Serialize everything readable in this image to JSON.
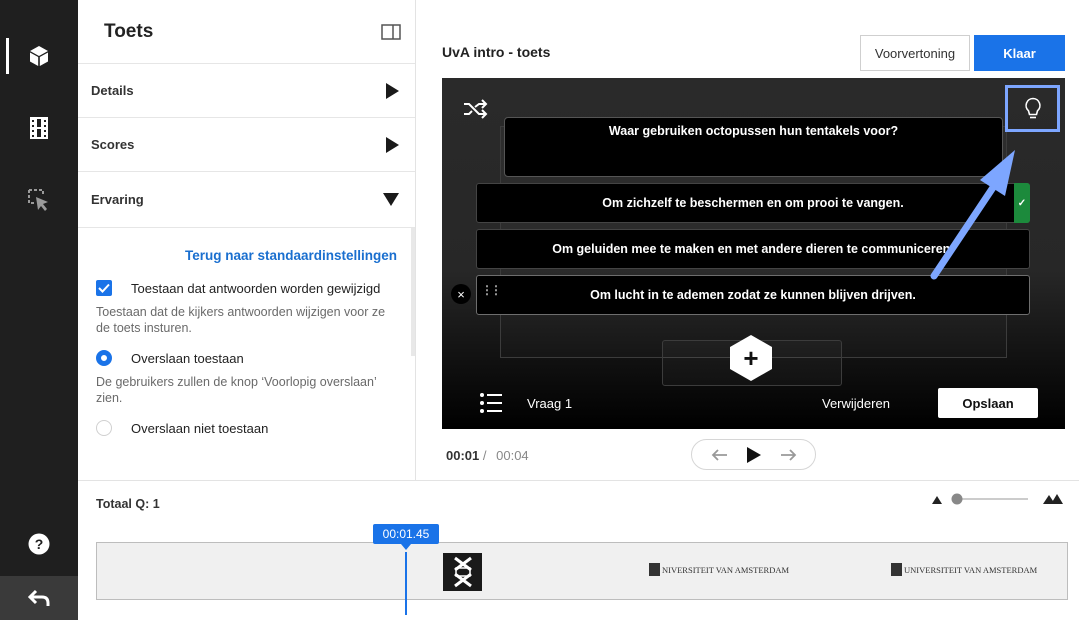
{
  "settings_panel": {
    "title": "Toets",
    "sections": [
      {
        "label": "Details",
        "state": "collapsed"
      },
      {
        "label": "Scores",
        "state": "collapsed"
      },
      {
        "label": "Ervaring",
        "state": "expanded"
      }
    ],
    "reset_link": "Terug naar standaardinstellingen",
    "options": [
      {
        "label": "Toestaan dat antwoorden worden gewijzigd",
        "control": "checkbox",
        "checked": true,
        "description": "Toestaan dat de kijkers antwoorden wijzigen voor ze de toets insturen."
      },
      {
        "label": "Overslaan toestaan",
        "control": "radio",
        "checked": true,
        "description": "De gebruikers zullen de knop ‘Voorlopig overslaan’ zien."
      },
      {
        "label": "Overslaan niet toestaan",
        "control": "radio",
        "checked": false,
        "description": ""
      }
    ]
  },
  "header": {
    "title": "UvA intro - toets",
    "preview_label": "Voorvertoning",
    "done_label": "Klaar"
  },
  "question": {
    "text": "Waar gebruiken octopussen hun tentakels voor?",
    "answers": [
      {
        "text": "Om zichzelf te beschermen en om prooi te vangen.",
        "correct": true
      },
      {
        "text": "Om geluiden mee te maken en met andere dieren te  communiceren.",
        "correct": false
      },
      {
        "text": "Om lucht in te ademen zodat ze kunnen blijven drijven.",
        "correct": false
      }
    ],
    "correct_mark": "✓",
    "close_mark": "×",
    "add_mark": "+",
    "number_label": "Vraag 1",
    "remove_label": "Verwijderen",
    "save_label": "Opslaan"
  },
  "playback": {
    "current_time": "00:01",
    "separator": "/",
    "total_time": "00:04"
  },
  "timeline": {
    "total_questions_label": "Totaal Q: 1",
    "playhead_time": "00:01.45",
    "frame_captions": [
      "NIVERSITEIT VAN AMSTERDAM",
      "UNIVERSITEIT VAN AMSTERDAM"
    ]
  },
  "colors": {
    "accent": "#1a73e8",
    "correct": "#1c8a3c",
    "annotation": "#7da6ff",
    "rail": "#1f1f1f"
  },
  "icons": {
    "rail": [
      "cube-icon",
      "film-icon",
      "cursor-select-icon",
      "help-icon",
      "back-arrow-icon"
    ],
    "panel_toggle": "sidebar-toggle-icon",
    "player": [
      "shuffle-icon",
      "lightbulb-icon",
      "question-list-icon",
      "plus-icon"
    ],
    "transport": [
      "arrow-left-icon",
      "play-icon",
      "arrow-right-icon"
    ]
  }
}
